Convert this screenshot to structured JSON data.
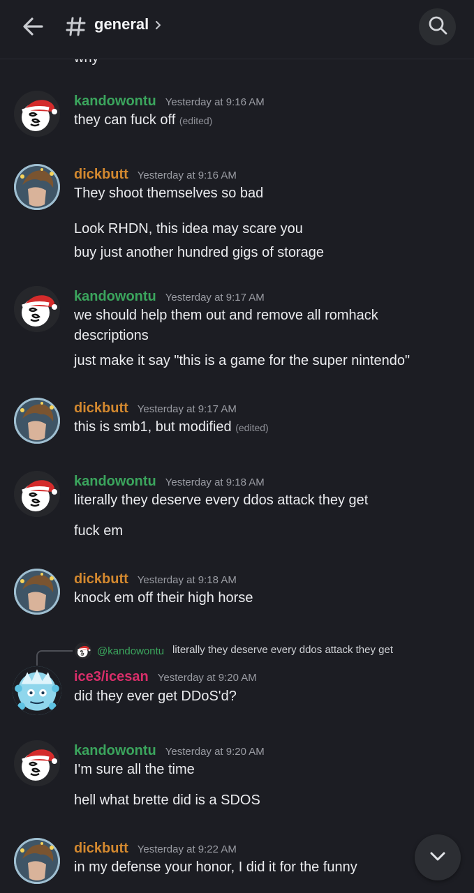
{
  "header": {
    "channel_name": "general",
    "back_icon": "arrow-left-icon",
    "channel_icon": "hash-icon",
    "chevron_icon": "chevron-right-icon",
    "search_icon": "search-icon"
  },
  "clipped_text": "why",
  "messages": [
    {
      "author": "kandowontu",
      "time": "Yesterday at 9:16 AM",
      "lines": [
        "they can fuck off"
      ],
      "edited": "(edited)"
    },
    {
      "author": "dickbutt",
      "time": "Yesterday at 9:16 AM",
      "lines": [
        "They shoot themselves so bad",
        "Look RHDN, this idea may scare you",
        "buy just another hundred gigs of storage"
      ]
    },
    {
      "author": "kandowontu",
      "time": "Yesterday at 9:17 AM",
      "lines": [
        "we should help them out and remove all romhack descriptions",
        "just make it say \"this is a game for the super nintendo\""
      ]
    },
    {
      "author": "dickbutt",
      "time": "Yesterday at 9:17 AM",
      "lines": [
        "this is smb1, but modified"
      ],
      "edited": "(edited)"
    },
    {
      "author": "kandowontu",
      "time": "Yesterday at 9:18 AM",
      "lines": [
        "literally they deserve every ddos attack they get",
        "fuck em"
      ]
    },
    {
      "author": "dickbutt",
      "time": "Yesterday at 9:18 AM",
      "lines": [
        "knock em off their high horse"
      ]
    },
    {
      "author": "ice3/icesan",
      "time": "Yesterday at 9:20 AM",
      "lines": [
        "did they ever get DDoS'd?"
      ],
      "reply": {
        "mention": "@kandowontu",
        "text": "literally they deserve every ddos attack they get"
      }
    },
    {
      "author": "kandowontu",
      "time": "Yesterday at 9:20 AM",
      "lines": [
        "I'm sure all the time",
        "hell what brette did is a SDOS"
      ]
    },
    {
      "author": "dickbutt",
      "time": "Yesterday at 9:22 AM",
      "lines": [
        "in my defense your honor, I did it for the funny"
      ]
    }
  ],
  "colors": {
    "kandowontu": "#3ba55d",
    "dickbutt": "#d4892f",
    "ice3": "#d92e6a",
    "background": "#1c1d23"
  },
  "scroll_button_icon": "chevron-down-icon"
}
